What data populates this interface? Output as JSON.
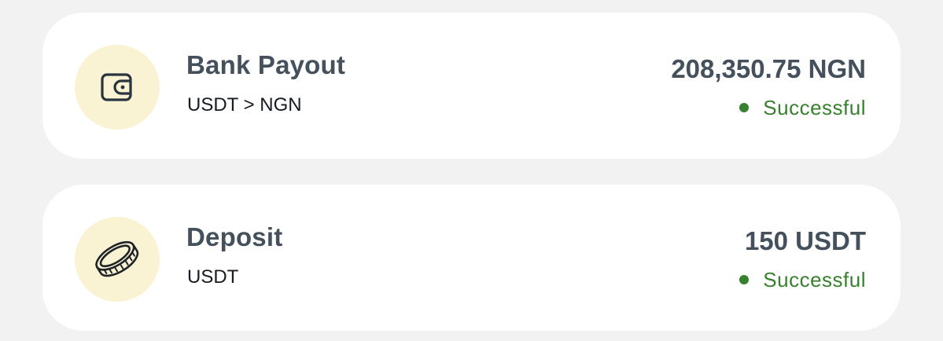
{
  "transactions": [
    {
      "icon": "wallet-icon",
      "title": "Bank Payout",
      "subtitle": "USDT > NGN",
      "amount": "208,350.75 NGN",
      "status": "Successful"
    },
    {
      "icon": "coin-icon",
      "title": "Deposit",
      "subtitle": "USDT",
      "amount": "150 USDT",
      "status": "Successful"
    }
  ],
  "colors": {
    "background": "#f2f2f2",
    "card": "#ffffff",
    "icon_circle": "#faf3d3",
    "title_text": "#44505c",
    "status_success": "#37812e"
  }
}
